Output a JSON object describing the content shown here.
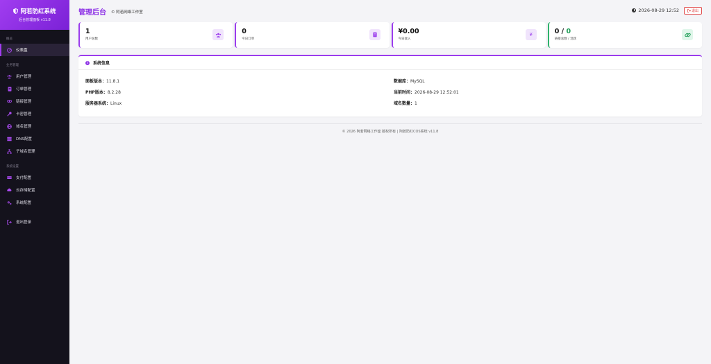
{
  "brand": {
    "title": "阿若防红系统",
    "subtitle": "后台管理面板 v11.8"
  },
  "sidebar": {
    "sections": [
      {
        "label": "概览",
        "items": [
          {
            "label": "仪表盘",
            "icon": "dashboard-icon",
            "active": true
          }
        ]
      },
      {
        "label": "业务管理",
        "items": [
          {
            "label": "用户管理",
            "icon": "users-icon"
          },
          {
            "label": "订单管理",
            "icon": "orders-icon"
          },
          {
            "label": "链接管理",
            "icon": "link-icon"
          },
          {
            "label": "卡密管理",
            "icon": "key-icon"
          },
          {
            "label": "域名管理",
            "icon": "globe-icon"
          },
          {
            "label": "DNS配置",
            "icon": "server-icon"
          },
          {
            "label": "子域名管理",
            "icon": "sitemap-icon"
          }
        ]
      },
      {
        "label": "系统设置",
        "items": [
          {
            "label": "支付配置",
            "icon": "payment-icon"
          },
          {
            "label": "云存储配置",
            "icon": "cloud-icon"
          },
          {
            "label": "系统配置",
            "icon": "cogs-icon"
          }
        ]
      }
    ],
    "logout": "退出登录"
  },
  "header": {
    "title": "管理后台",
    "copyright": "© 阿若网络工作室",
    "datetime": "2026-08-29 12:52",
    "logout_label": "退出"
  },
  "stats": [
    {
      "value": "1",
      "label": "用户总数",
      "icon": "users-icon"
    },
    {
      "value": "0",
      "label": "今日订单",
      "icon": "receipt-icon"
    },
    {
      "value": "¥0.00",
      "label": "今日收入",
      "icon": "yen-icon"
    },
    {
      "value_a": "0 / ",
      "value_b": "0",
      "label": "链接总数 / 活跃",
      "icon": "link-icon"
    }
  ],
  "system_info": {
    "title": "系统信息",
    "panel_version_label": "面板版本：",
    "panel_version": "11.8.1",
    "php_label": "PHP版本：",
    "php": "8.2.28",
    "os_label": "服务器系统：",
    "os": "Linux",
    "db_label": "数据库：",
    "db": "MySQL",
    "time_label": "当前时间：",
    "time": "2026-08-29 12:52:01",
    "domains_label": "域名数量：",
    "domains": "1"
  },
  "footer": "© 2026 阿若网络工作室 版权所有 | 阿若防红COS系统 v11.8",
  "colors": {
    "accent": "#9b3ced",
    "sidebar": "#14121c",
    "green": "#1f9d57",
    "danger": "#e14b4b"
  }
}
